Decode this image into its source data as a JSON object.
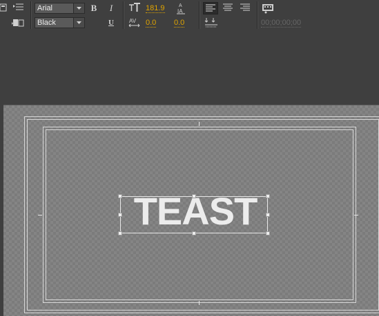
{
  "toolbar": {
    "font_family": "Arial",
    "font_style": "Black",
    "bold_label": "B",
    "italic_label": "I",
    "underline_label": "U",
    "font_size": "181.9",
    "kerning": "0.0",
    "leading": "0.0",
    "timecode": "00;00;00;00",
    "icons": [
      "title-type-icon",
      "tab-stops-icon",
      "template-icon",
      "font-size-icon",
      "baseline-icon",
      "kerning-icon",
      "align-left-icon",
      "align-center-icon",
      "align-right-icon",
      "tab-icon",
      "show-video-icon"
    ]
  },
  "canvas": {
    "title_text": "TEAST",
    "accent_color": "#e0a400"
  }
}
